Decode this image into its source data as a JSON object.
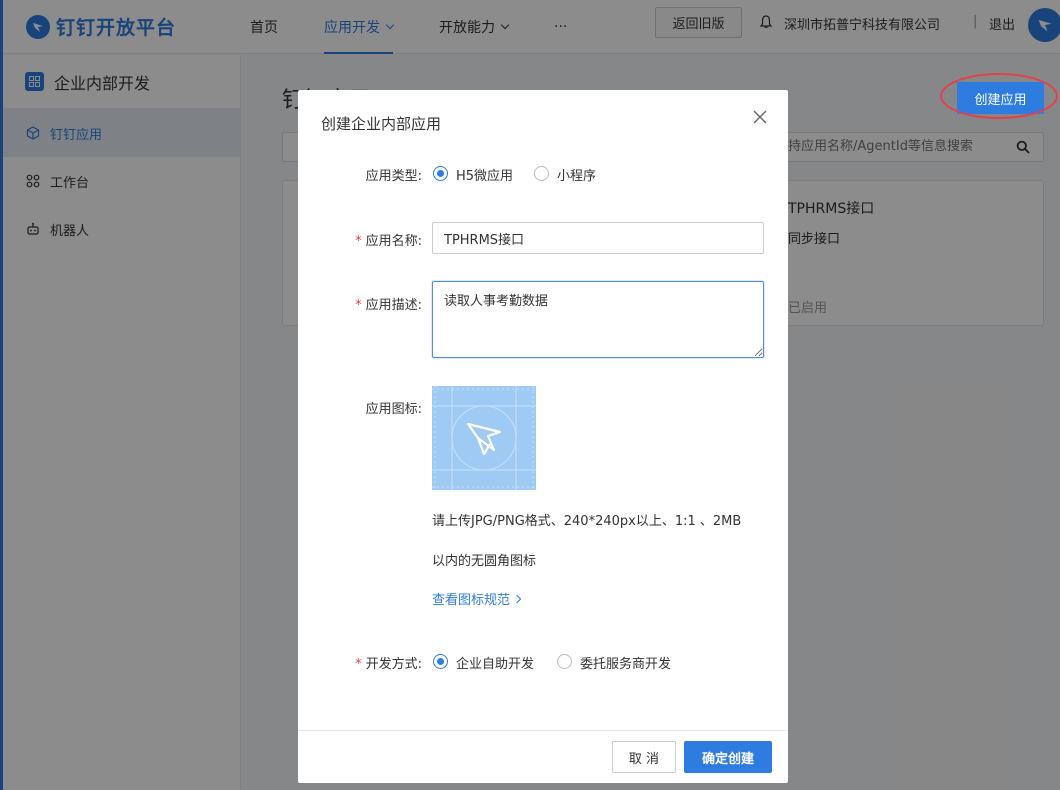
{
  "header": {
    "logo_text": "钉钉开放平台",
    "nav": [
      {
        "label": "首页"
      },
      {
        "label": "应用开发"
      },
      {
        "label": "开放能力"
      },
      {
        "label": "···"
      }
    ],
    "old_version_label": "返回旧版",
    "company": "深圳市拓普宁科技有限公司",
    "separator": "|",
    "logout_label": "退出"
  },
  "sidebar": {
    "title": "企业内部开发",
    "items": [
      {
        "label": "钉钉应用"
      },
      {
        "label": "工作台"
      },
      {
        "label": "机器人"
      }
    ]
  },
  "main": {
    "heading": "钉钉应用",
    "create_label": "创建应用",
    "search_placeholder": "支持应用名称/AgentId等信息搜索",
    "card_title": "TPHRMS接口",
    "card_desc": "同步接口",
    "card_status": "已启用"
  },
  "modal": {
    "title": "创建企业内部应用",
    "type_label": "应用类型:",
    "type_options": [
      "H5微应用",
      "小程序"
    ],
    "required_mark": "*",
    "name_label": "应用名称:",
    "name_value": "TPHRMS接口",
    "desc_label": "应用描述:",
    "desc_value": "读取人事考勤数据",
    "icon_label": "应用图标:",
    "hint_line1": "请上传JPG/PNG格式、240*240px以上、1:1 、2MB",
    "hint_line2": "以内的无圆角图标",
    "spec_link": "查看图标规范",
    "dev_label": "开发方式:",
    "dev_options": [
      "企业自助开发",
      "委托服务商开发"
    ],
    "cancel_label": "取 消",
    "confirm_label": "确定创建"
  },
  "colors": {
    "accent": "#2f7ce0",
    "annotation_red": "#e5404a",
    "icon_placeholder": "#9fcaf3"
  }
}
